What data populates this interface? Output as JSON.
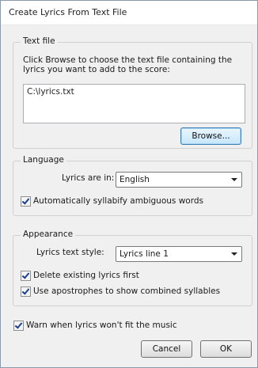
{
  "window": {
    "title": "Create Lyrics From Text File"
  },
  "text_file": {
    "group_label": "Text file",
    "description": "Click Browse to choose the text file containing the lyrics you want to add to the score:",
    "path_value": "C:\\lyrics.txt",
    "browse_label": "Browse..."
  },
  "language": {
    "group_label": "Language",
    "lyrics_in_label": "Lyrics are in:",
    "lyrics_in_value": "English",
    "auto_syllabify_label": "Automatically syllabify ambiguous words",
    "auto_syllabify_checked": true
  },
  "appearance": {
    "group_label": "Appearance",
    "style_label": "Lyrics text style:",
    "style_value": "Lyrics line 1",
    "delete_existing_label": "Delete existing lyrics first",
    "delete_existing_checked": true,
    "apostrophes_label": "Use apostrophes to show combined syllables",
    "apostrophes_checked": true
  },
  "footer": {
    "warn_label": "Warn when lyrics won't fit the music",
    "warn_checked": true,
    "cancel_label": "Cancel",
    "ok_label": "OK"
  }
}
